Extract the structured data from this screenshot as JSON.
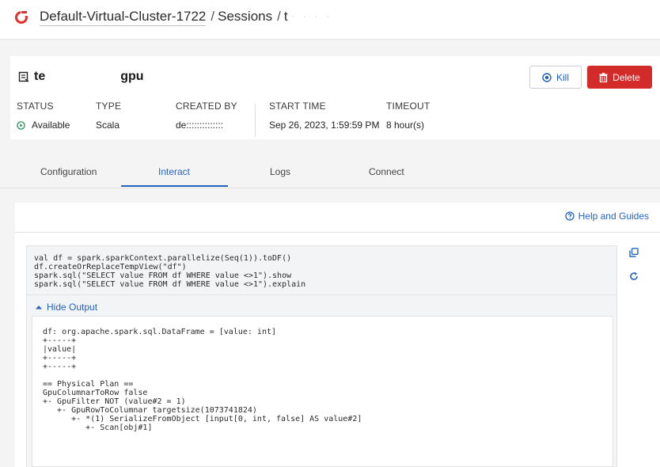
{
  "breadcrumb": {
    "cluster": "Default-Virtual-Cluster-1722",
    "sep1": "/",
    "sessions": "Sessions",
    "sep2": "/",
    "current": "t",
    "current_tail": "· ·  · ·"
  },
  "session": {
    "title_prefix": "te",
    "title_suffix": "gpu"
  },
  "actions": {
    "kill_label": "Kill",
    "delete_label": "Delete"
  },
  "meta": {
    "status_label": "STATUS",
    "status_value": "Available",
    "type_label": "TYPE",
    "type_value": "Scala",
    "created_label": "CREATED BY",
    "created_value": "de::::::::::::::",
    "start_label": "START TIME",
    "start_value": "Sep 26, 2023, 1:59:59 PM",
    "timeout_label": "TIMEOUT",
    "timeout_value": "8 hour(s)"
  },
  "tabs": [
    {
      "label": "Configuration"
    },
    {
      "label": "Interact"
    },
    {
      "label": "Logs"
    },
    {
      "label": "Connect"
    }
  ],
  "help_label": "Help and Guides",
  "editor": {
    "lines": [
      "val df = spark.sparkContext.parallelize(Seq(1)).toDF()",
      "df.createOrReplaceTempView(\"df\")",
      "spark.sql(\"SELECT value FROM df WHERE value <>1\").show",
      "spark.sql(\"SELECT value FROM df WHERE value <>1\").explain"
    ]
  },
  "hide_output_label": "Hide Output",
  "output": {
    "lines": [
      "df: org.apache.spark.sql.DataFrame = [value: int]",
      "+-----+",
      "|value|",
      "+-----+",
      "+-----+",
      "",
      "== Physical Plan ==",
      "GpuColumnarToRow false",
      "+- GpuFilter NOT (value#2 = 1)",
      "   +- GpuRowToColumnar targetsize(1073741824)",
      "      +- *(1) SerializeFromObject [input[0, int, false] AS value#2]",
      "         +- Scan[obj#1]"
    ]
  },
  "colors": {
    "accent": "#2563c0",
    "danger": "#d32a2a",
    "status_ok": "#2e8b57",
    "logo": "#e0312b"
  },
  "icons": {
    "logo": "cloudera-logo-icon",
    "session": "session-icon",
    "kill": "stop-circle-icon",
    "delete": "trash-icon",
    "status": "play-circle-icon",
    "help": "question-circle-icon",
    "copy": "copy-icon",
    "refresh": "refresh-icon",
    "collapse": "caret-up-icon"
  }
}
